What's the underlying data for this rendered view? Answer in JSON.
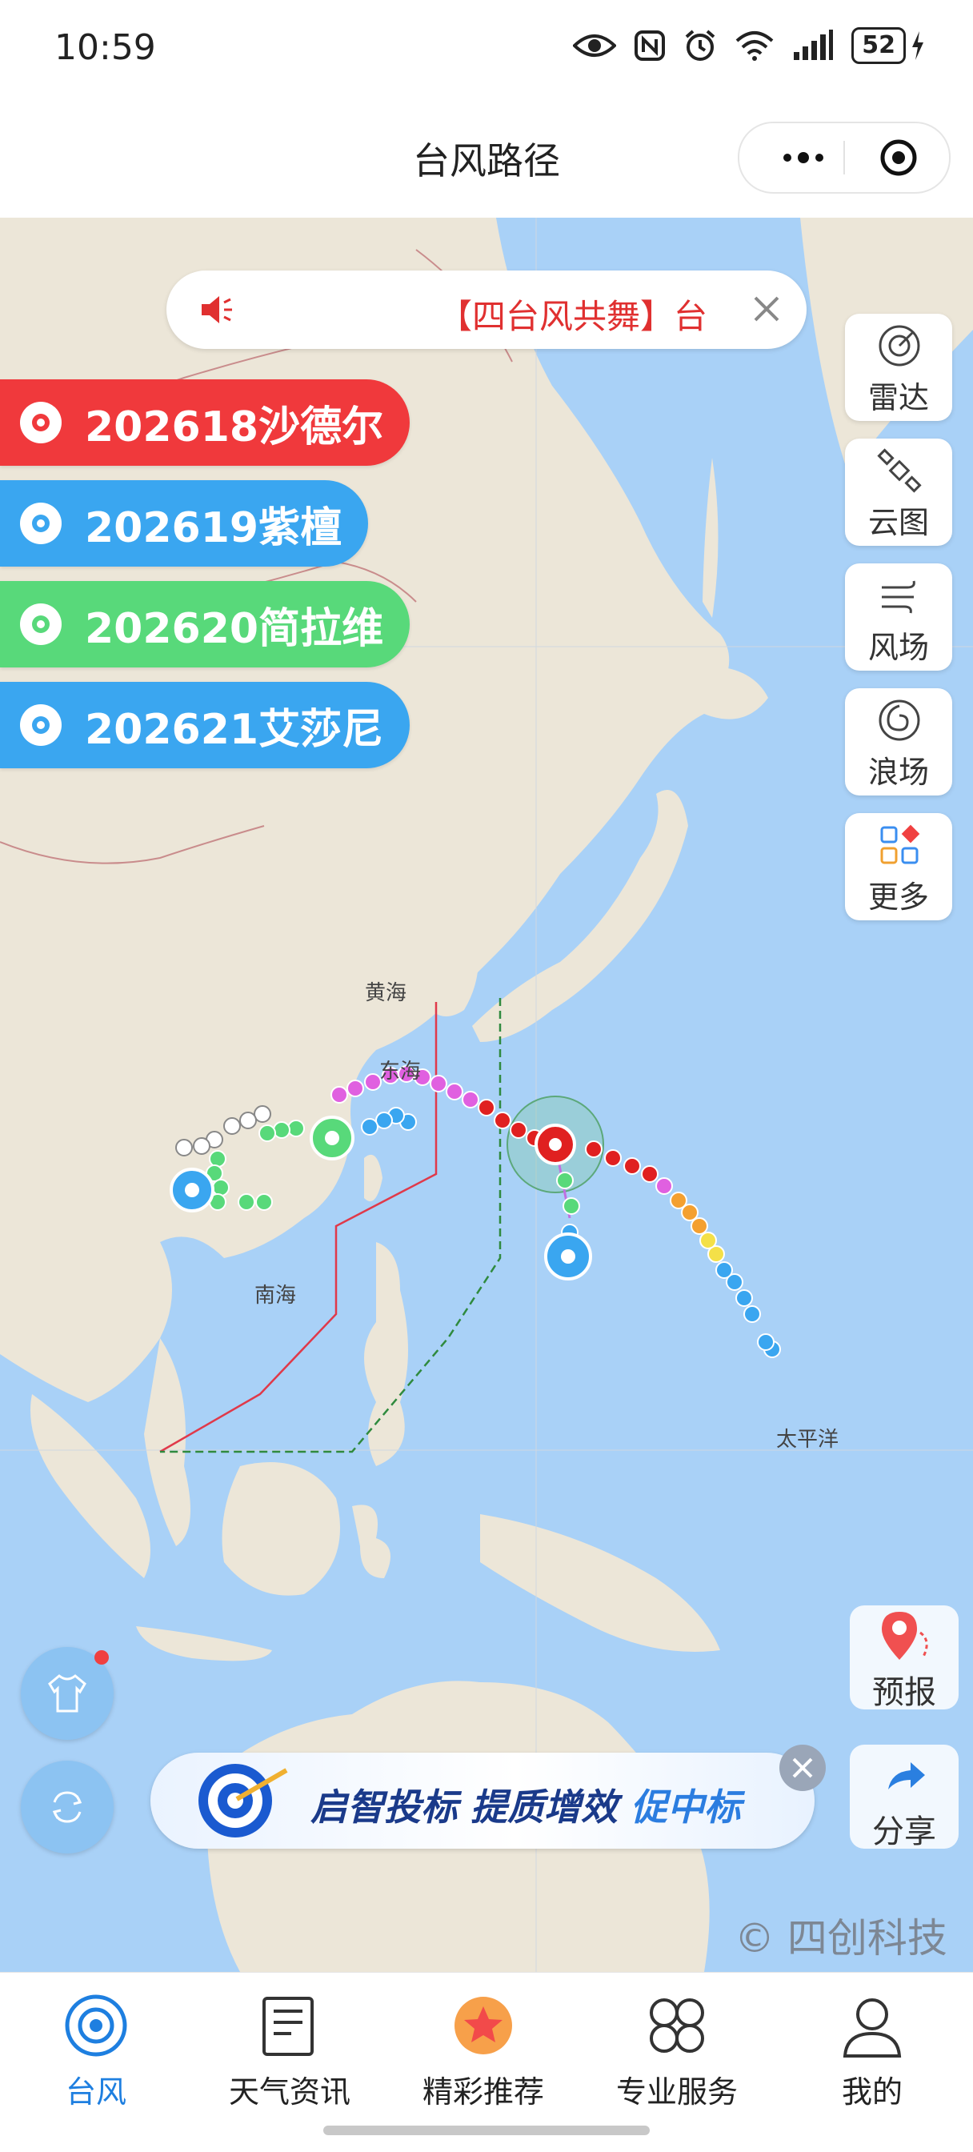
{
  "status": {
    "time": "10:59",
    "battery": "52"
  },
  "header": {
    "title": "台风路径"
  },
  "notice": {
    "text": "【四台风共舞】台"
  },
  "typhoons": [
    {
      "label": "202618沙德尔",
      "color": "#f0393c"
    },
    {
      "label": "202619紫檀",
      "color": "#3aa6f0"
    },
    {
      "label": "202620简拉维",
      "color": "#58d97a"
    },
    {
      "label": "202621艾莎尼",
      "color": "#3aa6f0"
    }
  ],
  "tools": [
    {
      "label": "雷达",
      "icon": "radar-icon"
    },
    {
      "label": "云图",
      "icon": "satellite-icon"
    },
    {
      "label": "风场",
      "icon": "wind-icon"
    },
    {
      "label": "浪场",
      "icon": "wave-icon"
    },
    {
      "label": "更多",
      "icon": "grid-icon"
    }
  ],
  "map": {
    "labels": {
      "yellow_sea": "黄海",
      "east_sea": "东海",
      "south_sea": "南海",
      "pacific": "太平洋"
    }
  },
  "forecast": {
    "label": "预报"
  },
  "share": {
    "label": "分享"
  },
  "banner": {
    "text_a": "启智投标 提质增效 ",
    "text_b": "促中标"
  },
  "watermark": "© 四创科技",
  "nav": [
    {
      "label": "台风",
      "icon": "typhoon-icon",
      "active": true
    },
    {
      "label": "天气资讯",
      "icon": "news-icon"
    },
    {
      "label": "精彩推荐",
      "icon": "star-icon"
    },
    {
      "label": "专业服务",
      "icon": "service-icon"
    },
    {
      "label": "我的",
      "icon": "user-icon"
    }
  ]
}
